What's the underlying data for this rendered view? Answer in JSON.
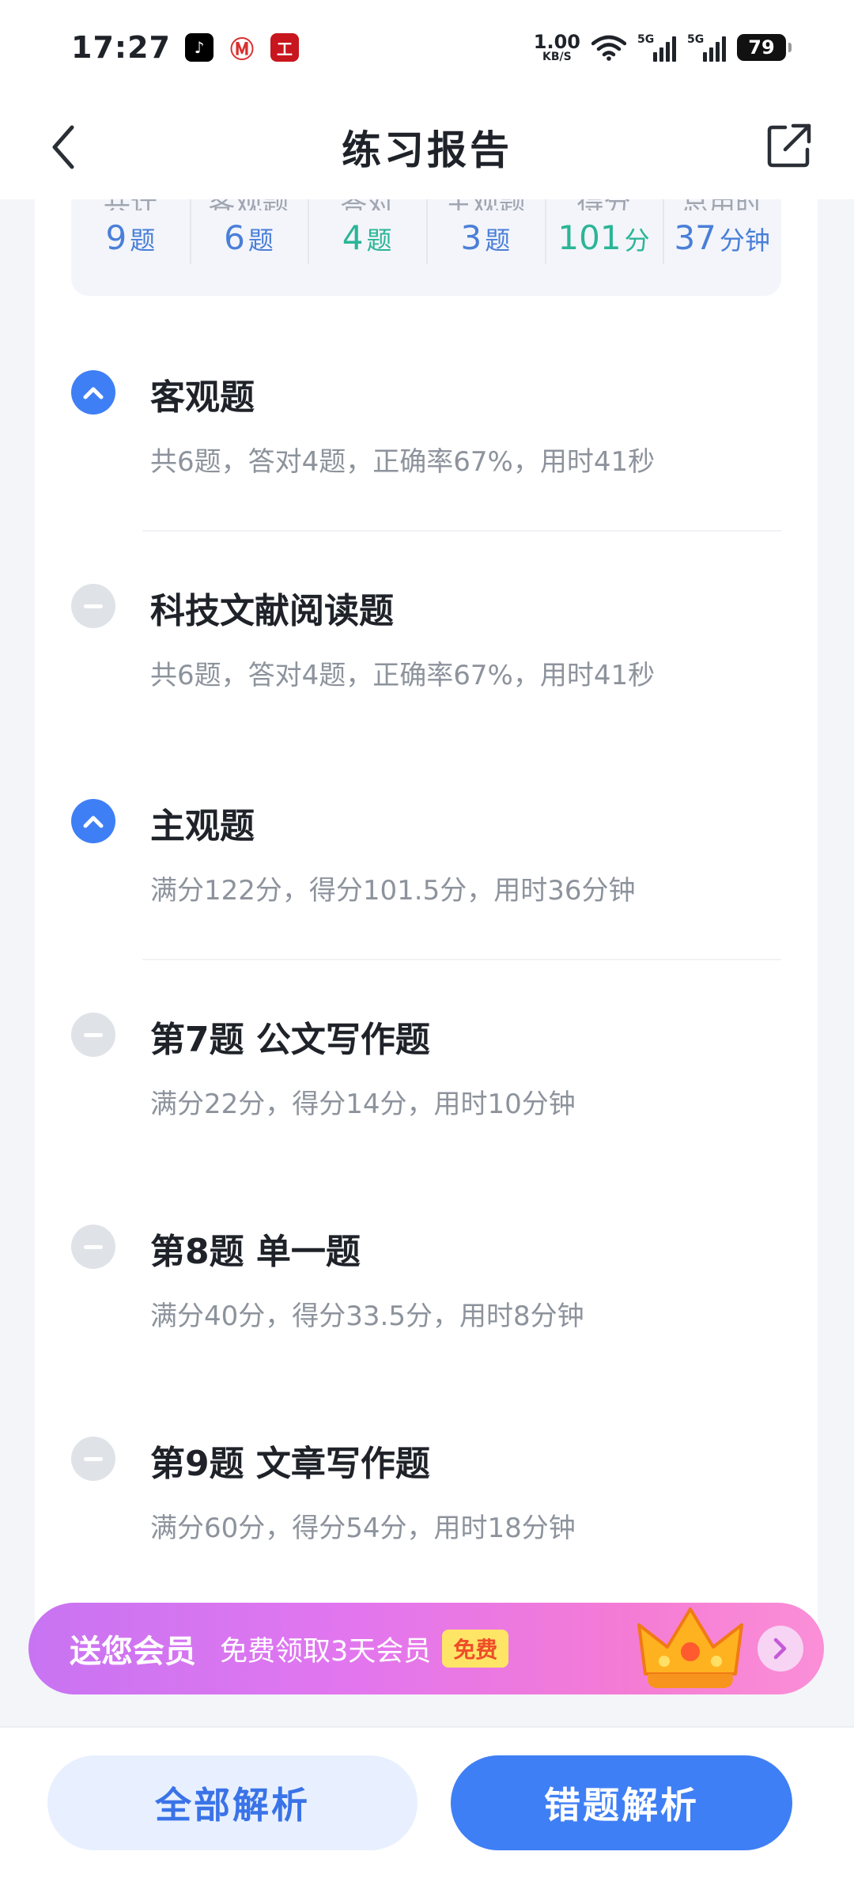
{
  "status_bar": {
    "time": "17:27",
    "net_speed_value": "1.00",
    "net_speed_unit": "KB/S",
    "sim1": "5G",
    "sim2": "5G",
    "battery": "79"
  },
  "nav": {
    "title": "练习报告"
  },
  "stats": [
    {
      "label": "共计",
      "value": "9",
      "unit": "题",
      "color": "#4a7fd8"
    },
    {
      "label": "客观题",
      "value": "6",
      "unit": "题",
      "color": "#4a7fd8"
    },
    {
      "label": "答对",
      "value": "4",
      "unit": "题",
      "color": "#2bb597"
    },
    {
      "label": "主观题",
      "value": "3",
      "unit": "题",
      "color": "#4a7fd8"
    },
    {
      "label": "得分",
      "value": "101",
      "unit": "分",
      "color": "#2bb597"
    },
    {
      "label": "总用时",
      "value": "37",
      "unit": "分钟",
      "color": "#4a7fd8"
    }
  ],
  "sections": [
    {
      "title": "客观题",
      "desc": "共6题，答对4题，正确率67%，用时41秒",
      "state": "expanded"
    },
    {
      "title": "科技文献阅读题",
      "desc": "共6题，答对4题，正确率67%，用时41秒",
      "state": "item"
    },
    {
      "title": "主观题",
      "desc": "满分122分，得分101.5分，用时36分钟",
      "state": "expanded"
    },
    {
      "title": "第7题 公文写作题",
      "desc": "满分22分，得分14分，用时10分钟",
      "state": "item"
    },
    {
      "title": "第8题 单一题",
      "desc": "满分40分，得分33.5分，用时8分钟",
      "state": "item"
    },
    {
      "title": "第9题 文章写作题",
      "desc": "满分60分，得分54分，用时18分钟",
      "state": "item"
    }
  ],
  "promo": {
    "main": "送您会员",
    "sub": "免费领取3天会员",
    "badge": "免费"
  },
  "bottom": {
    "all_analysis": "全部解析",
    "wrong_analysis": "错题解析"
  }
}
